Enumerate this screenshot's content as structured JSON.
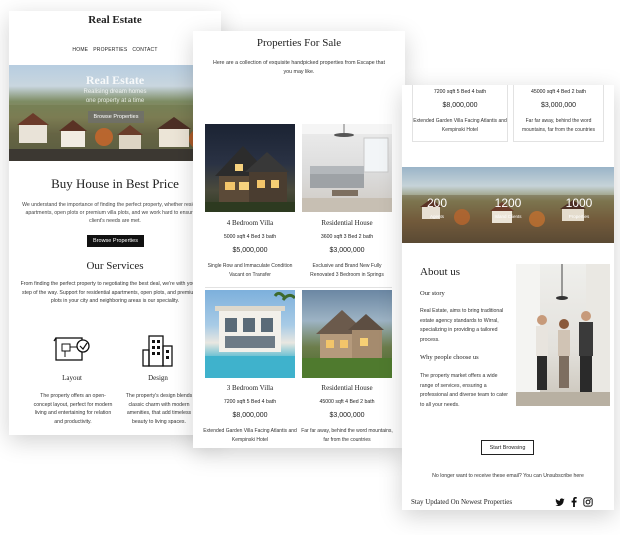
{
  "panel_left": {
    "brand": "Real Estate",
    "nav": [
      "HOME",
      "PROPERTIES",
      "CONTACT"
    ],
    "hero": {
      "title": "Real Estate",
      "subtitle_1": "Realising dream homes",
      "subtitle_2": "one property at a time",
      "button": "Browse Properties"
    },
    "headline": "Buy House in Best Price",
    "intro": "We understand the importance of finding the perfect property, whether residential apartments, open plots or premium villa plots, and we work hard to ensure our client's needs are met.",
    "browse_button": "Browse Properties",
    "services_title": "Our Services",
    "services_text": "From finding the perfect property to negotiating the best deal, we're with you every step of the way. Support for residential apartments, open plots, and premium villa plots in your city and neighboring areas is our speciality.",
    "services": [
      {
        "icon": "blueprint-icon",
        "title": "Layout",
        "text": "The property offers an open-concept layout, perfect for modern living and entertaining for relation and productivity."
      },
      {
        "icon": "building-icon",
        "title": "Design",
        "text": "The property's design blends classic charm with modern amenities, that add timeless beauty to living spaces."
      }
    ]
  },
  "panel_middle": {
    "title": "Properties For Sale",
    "intro": "Here are a collection of exquisite handpicked properties from Escape that you may like.",
    "properties": [
      {
        "name": "4 Bedroom Villa",
        "specs": "5000 sqft 4 Bed 3 bath",
        "price": "$5,000,000",
        "desc": "Single Row and Immaculate Condition Vacant on Transfer"
      },
      {
        "name": "Residential House",
        "specs": "3600 sqft 3 Bed 2 bath",
        "price": "$3,000,000",
        "desc": "Exclusive and Brand New Fully Renovated 3 Bedroom in Springs"
      },
      {
        "name": "3 Bedroom Villa",
        "specs": "7200 sqft 5 Bed 4 bath",
        "price": "$8,000,000",
        "desc": "Extended Garden Villa Facing Atlantis and Kempinski Hotel"
      },
      {
        "name": "Residential House",
        "specs": "45000 sqft 4 Bed 2 bath",
        "price": "$3,000,000",
        "desc": "Far far away, behind the word mountains, far from the countries"
      }
    ]
  },
  "panel_right": {
    "top_cards": [
      {
        "specs": "7200 sqft 5 Bed 4 bath",
        "price": "$8,000,000",
        "desc": "Extended Garden Villa Facing Atlantis and Kempinski Hotel"
      },
      {
        "specs": "45000 sqft 4 Bed 2 bath",
        "price": "$3,000,000",
        "desc": "Far far away, behind the word mountains, far from the countries"
      }
    ],
    "stats": [
      {
        "value": "200",
        "label": "Agents"
      },
      {
        "value": "1200",
        "label": "Island Clients"
      },
      {
        "value": "1000",
        "label": "Properties"
      }
    ],
    "about_title": "About us",
    "story_title": "Our story",
    "story_text": "Real Estate, aims to bring traditional estate agency standards to Wirral, specializing in providing a tailored process.",
    "why_title": "Why people choose us",
    "why_text": "The property market offers a wide range of services, ensuring a professional and diverse team to cater to all your needs.",
    "start_button": "Start Browsing",
    "unsubscribe_text": "No longer want to receive these email? You can",
    "unsubscribe_link": "Unsubscribe here",
    "footer_text": "Stay Updated On Newest Properties",
    "social": [
      "twitter-icon",
      "facebook-icon",
      "instagram-icon"
    ]
  }
}
